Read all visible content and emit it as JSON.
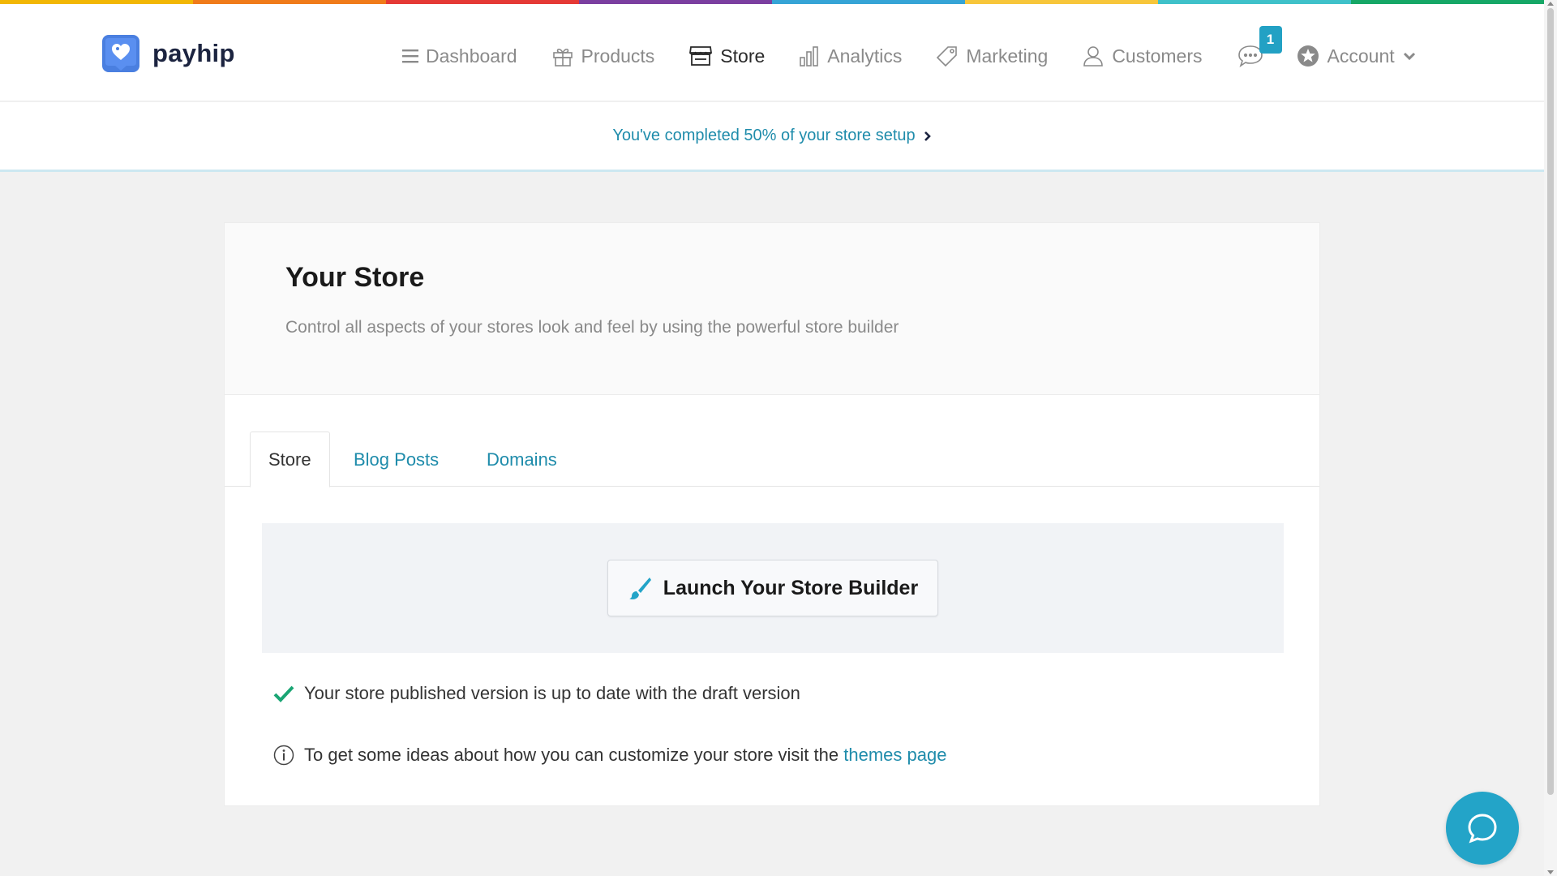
{
  "brand": {
    "name": "payhip"
  },
  "colors": {
    "accent": "#1f8cab",
    "help_button": "#23a4c8",
    "check_green": "#1aa574",
    "rainbow": [
      "#f2b705",
      "#f07b1a",
      "#e53935",
      "#7b3fa0",
      "#35a4d6",
      "#f7c63a",
      "#3fc1c9",
      "#16a766"
    ]
  },
  "nav": {
    "items": [
      {
        "label": "Dashboard",
        "icon": "menu-icon",
        "active": false
      },
      {
        "label": "Products",
        "icon": "gift-icon",
        "active": false
      },
      {
        "label": "Store",
        "icon": "store-icon",
        "active": true
      },
      {
        "label": "Analytics",
        "icon": "bar-chart-icon",
        "active": false
      },
      {
        "label": "Marketing",
        "icon": "tag-icon",
        "active": false
      },
      {
        "label": "Customers",
        "icon": "user-icon",
        "active": false
      }
    ],
    "messages_badge": "1",
    "account_label": "Account"
  },
  "setup": {
    "text": "You've completed 50% of your store setup",
    "percent": 50
  },
  "page": {
    "title": "Your Store",
    "subtitle": "Control all aspects of your stores look and feel by using the powerful store builder"
  },
  "tabs": [
    {
      "label": "Store",
      "active": true
    },
    {
      "label": "Blog Posts",
      "active": false
    },
    {
      "label": "Domains",
      "active": false
    }
  ],
  "builder_button": {
    "label": "Launch Your Store Builder",
    "icon": "paintbrush-icon"
  },
  "status": {
    "published_text": "Your store published version is up to date with the draft version",
    "ideas_text": "To get some ideas about how you can customize your store visit the",
    "ideas_link": "themes page"
  }
}
